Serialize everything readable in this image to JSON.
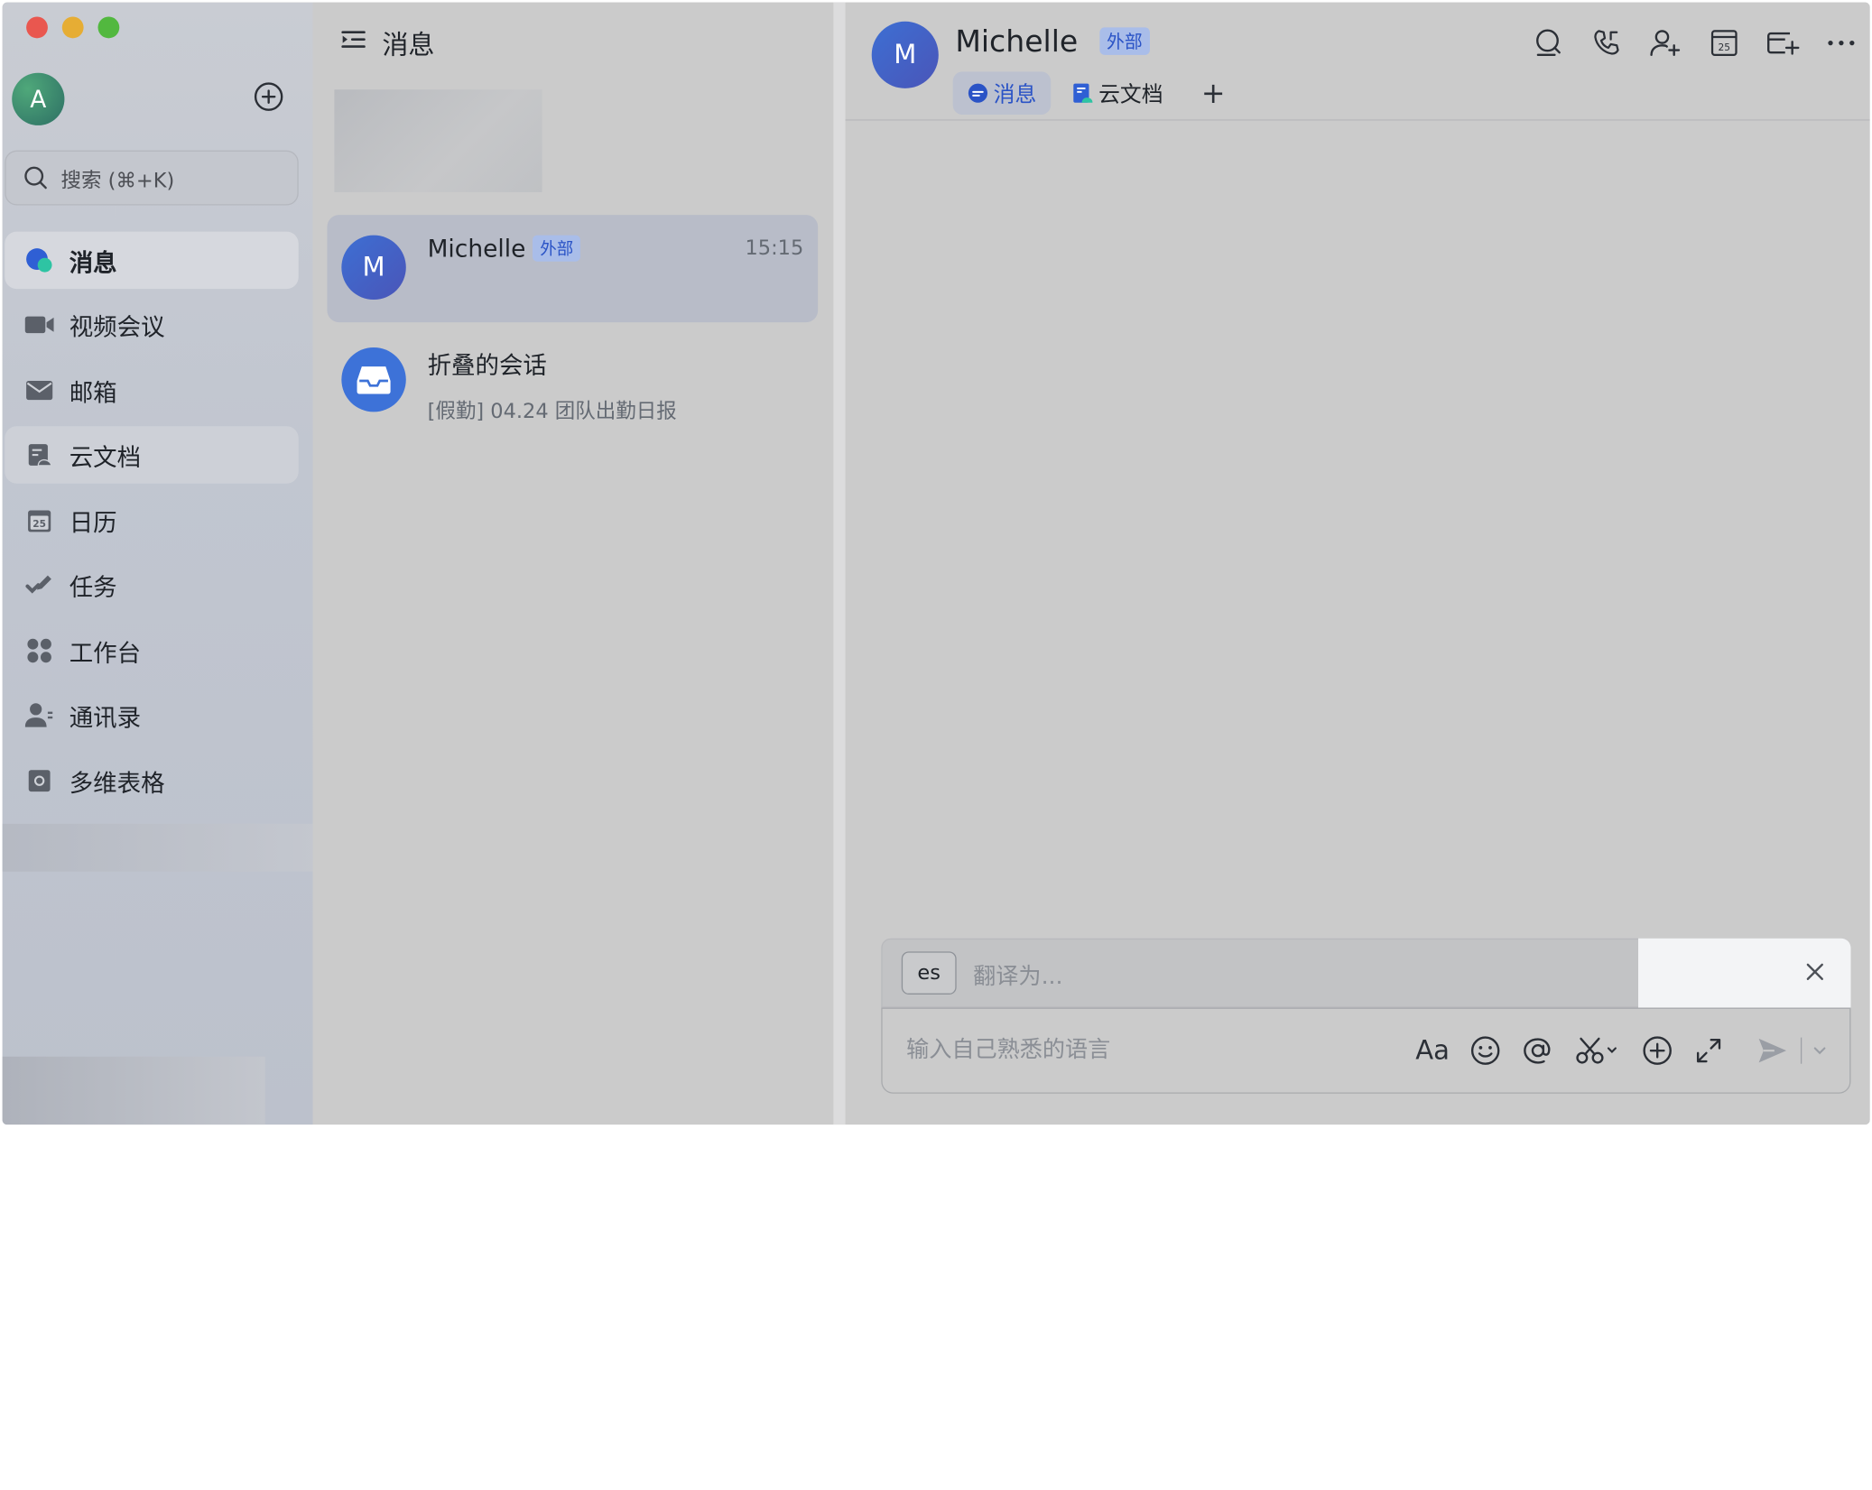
{
  "sidebar": {
    "avatar_letter": "A",
    "search": {
      "label": "搜索 (⌘+K)"
    },
    "items": [
      {
        "id": "messages",
        "label": "消息",
        "icon": "message-bubble-icon"
      },
      {
        "id": "video",
        "label": "视频会议",
        "icon": "video-camera-icon"
      },
      {
        "id": "mail",
        "label": "邮箱",
        "icon": "mail-icon"
      },
      {
        "id": "docs",
        "label": "云文档",
        "icon": "cloud-doc-icon"
      },
      {
        "id": "calendar",
        "label": "日历",
        "icon": "calendar-icon",
        "day": "25"
      },
      {
        "id": "tasks",
        "label": "任务",
        "icon": "task-check-icon"
      },
      {
        "id": "workplace",
        "label": "工作台",
        "icon": "workplace-grid-icon"
      },
      {
        "id": "contacts",
        "label": "通讯录",
        "icon": "contacts-icon"
      },
      {
        "id": "base",
        "label": "多维表格",
        "icon": "bitable-icon"
      }
    ]
  },
  "list": {
    "title": "消息",
    "chats": [
      {
        "avatar": "M",
        "name": "Michelle",
        "badge": "外部",
        "time": "15:15"
      },
      {
        "name": "折叠的会话",
        "subtitle": "[假勤] 04.24 团队出勤日报"
      }
    ]
  },
  "chat": {
    "avatar": "M",
    "name": "Michelle",
    "badge": "外部",
    "tabs": [
      {
        "label": "消息",
        "active": true
      },
      {
        "label": "云文档",
        "active": false
      }
    ],
    "tab_add": "+",
    "header_icons": [
      "search-icon",
      "phone-icon",
      "add-member-icon",
      "calendar-icon",
      "add-tab-icon",
      "more-icon"
    ],
    "calendar_day": "25",
    "translate": {
      "lang": "es",
      "placeholder": "翻译为..."
    },
    "composer": {
      "placeholder": "输入自己熟悉的语言",
      "format_label": "Aa"
    }
  },
  "colors": {
    "accent": "#2a53c6",
    "badge_bg": "#a9bde9",
    "avatar_blue": "#3d6fd3",
    "avatar_green": "#3f8c6e"
  }
}
